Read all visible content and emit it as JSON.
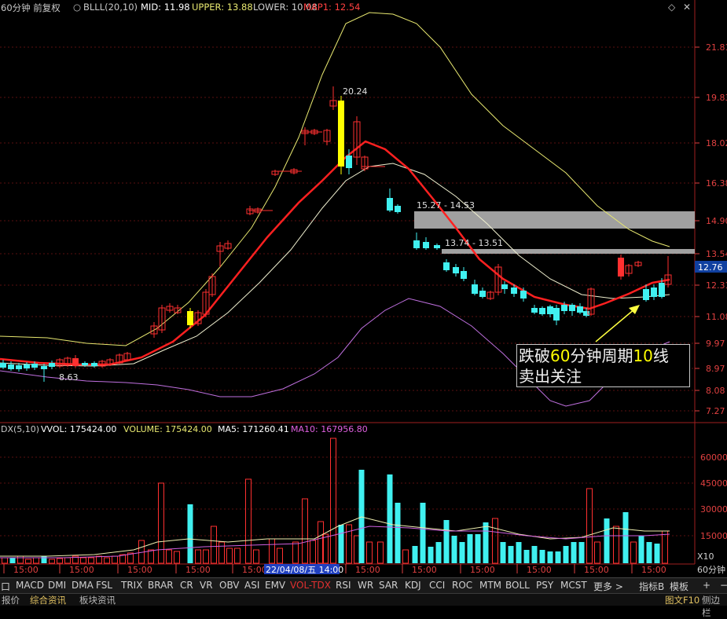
{
  "header": {
    "period": "60分钟 前复权",
    "indicator": "BLLL(20,10)",
    "mid": "MID: 11.98",
    "upper": "UPPER: 13.88",
    "lower": "LOWER: 10.08",
    "map1": "MAP1: 12.54"
  },
  "price_axis": {
    "ticks": [
      "21.81",
      "19.83",
      "18.02",
      "16.38",
      "14.90",
      "13.54",
      "12.31",
      "11.08",
      "9.97",
      "8.97",
      "8.08",
      "7.27"
    ],
    "current": "12.76"
  },
  "annotations": {
    "high_label": "20.24",
    "low_label": "8.63",
    "zone1": "15.27 - 14.53",
    "zone2": "13.74 - 13.51",
    "note_line1_a": "跌破",
    "note_line1_b": "60",
    "note_line1_c": "分钟周期",
    "note_line1_d": "10",
    "note_line1_e": "线",
    "note_line2": "卖出关注"
  },
  "volume_header": {
    "name": "DX(5,10)",
    "vvol": "VVOL: 175424.00",
    "volume": "VOLUME: 175424.00",
    "ma5": "MA5: 171260.41",
    "ma10": "MA10: 167956.80"
  },
  "volume_axis": {
    "ticks": [
      "60000",
      "45000",
      "30000",
      "15000"
    ],
    "unit": "X10"
  },
  "time_axis": {
    "labels": [
      "15:00",
      "15:00",
      "15:00",
      "15:00",
      "15:00",
      "15:00",
      "15:00",
      "15:00",
      "15:00",
      "15:00",
      "15:00",
      "15:00"
    ],
    "cursor": "22/04/08/五 14:00",
    "period_tag": "60分钟"
  },
  "toolbar": {
    "items": [
      "口",
      "MACD",
      "DMI",
      "DMA",
      "FSL",
      "TRIX",
      "BRAR",
      "CR",
      "VR",
      "OBV",
      "ASI",
      "EMV",
      "VOL-TDX",
      "RSI",
      "WR",
      "SAR",
      "KDJ",
      "CCI",
      "ROC",
      "MTM",
      "BOLL",
      "PSY",
      "MCST",
      "更多 >",
      "指标B",
      "模板",
      "+",
      "−"
    ]
  },
  "bottombar": {
    "quote": "报价",
    "tab1": "综合资讯",
    "tab2": "板块资讯",
    "f10": "图文F10",
    "sidebar": "侧边栏"
  },
  "colors": {
    "background": "#000000",
    "axis": "#e04040",
    "up_candle": "#ff3030",
    "down_candle": "#40f0f0",
    "mid_line": "#ff2020",
    "upper_line": "#e8e870",
    "lower_line": "#c070e0",
    "inner_line": "#f0f0d0",
    "zone": "#a0a0a0",
    "highlight_candle": "#ffff00"
  }
}
